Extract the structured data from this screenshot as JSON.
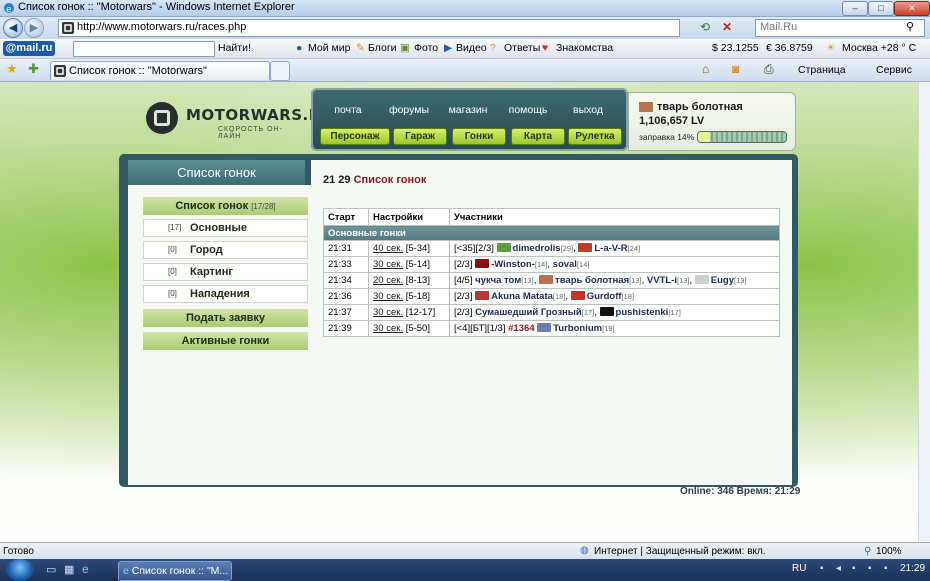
{
  "window": {
    "title": "Список гонок :: \"Motorwars\" - Windows Internet Explorer"
  },
  "address_bar": {
    "url": "http://www.motorwars.ru/races.php",
    "search_placeholder": "Mail.Ru"
  },
  "mail_toolbar": {
    "logo": "@mail.ru",
    "find_label": "Найти!",
    "items": [
      "Мой мир",
      "Блоги",
      "Фото",
      "Видео",
      "Ответы",
      "Знакомства"
    ],
    "usd": "$ 23.1255",
    "eur": "€ 36.8759",
    "weather": "Москва +28 ° C"
  },
  "tab": {
    "title": "Список гонок :: \"Motorwars\""
  },
  "ie_commands": {
    "page": "Страница",
    "tools": "Сервис"
  },
  "site": {
    "logo_name": "MOTORWARS.RU",
    "logo_sub": "СКОРОСТЬ ОН-ЛАЙН",
    "nav_top": [
      "почта",
      "форумы",
      "магазин",
      "помощь",
      "выход"
    ],
    "nav_bottom": [
      "Персонаж",
      "Гараж",
      "Гонки",
      "Карта",
      "Рулетка"
    ],
    "user": {
      "name": "тварь болотная",
      "money": "1,106,657 LV",
      "fuel_label": "заправка 14%",
      "fuel_percent": 14
    },
    "panel_title": "Список гонок",
    "menu": {
      "header": "Список гонок",
      "header_count": "[17/28]",
      "items": [
        {
          "count": "[17]",
          "label": "Основные"
        },
        {
          "count": "[0]",
          "label": "Город"
        },
        {
          "count": "[0]",
          "label": "Картинг"
        },
        {
          "count": "[0]",
          "label": "Нападения"
        }
      ],
      "submit": "Подать заявку",
      "active": "Активные гонки"
    },
    "heading_time": "21 29",
    "heading_title": "Список гонок",
    "table": {
      "headers": [
        "Старт",
        "Настройки",
        "Участники"
      ],
      "group": "Основные гонки",
      "rows": [
        {
          "start": "21:31",
          "time": "40 сек.",
          "range": "[5-34]",
          "prefix": "[<35][2/3]",
          "participants": [
            {
              "name": "dimedrolis",
              "level": "[29]",
              "color": "#5aa03a"
            },
            {
              "name": "L-a-V-R",
              "level": "[24]",
              "color": "#c0392b"
            }
          ]
        },
        {
          "start": "21:33",
          "time": "30 сек.",
          "range": "[5-14]",
          "prefix": "[2/3]",
          "participants": [
            {
              "name": "-Winston-",
              "level": "[14]",
              "color": "#8b1111"
            },
            {
              "name": "soval",
              "level": "[14]",
              "color": ""
            }
          ]
        },
        {
          "start": "21:34",
          "time": "20 сек.",
          "range": "[8-13]",
          "prefix": "[4/5]",
          "participants": [
            {
              "name": "чукча том",
              "level": "[13]",
              "color": ""
            },
            {
              "name": "тварь болотная",
              "level": "[13]",
              "color": "#b7744a"
            },
            {
              "name": "VVTL-i",
              "level": "[13]",
              "color": ""
            },
            {
              "name": "Eugy",
              "level": "[13]",
              "color": "#cfcfcf"
            }
          ]
        },
        {
          "start": "21:36",
          "time": "30 сек.",
          "range": "[5-18]",
          "prefix": "[2/3]",
          "participants": [
            {
              "name": "Akuna Matata",
              "level": "[18]",
              "color": "#b33a3a"
            },
            {
              "name": "Gurdoff",
              "level": "[18]",
              "color": "#d0302a"
            }
          ]
        },
        {
          "start": "21:37",
          "time": "30 сек.",
          "range": "[12-17]",
          "prefix": "[2/3]",
          "participants": [
            {
              "name": "Сумашедший Грозный",
              "level": "[17]",
              "color": ""
            },
            {
              "name": "pushistenki",
              "level": "[17]",
              "color": "#111111"
            }
          ]
        },
        {
          "start": "21:39",
          "time": "30 сек.",
          "range": "[5-50]",
          "prefix": "[<4][БТ][1/3]",
          "highlight": "#1364",
          "participants": [
            {
              "name": "Turbonium",
              "level": "[19]",
              "color": "#6b7fae"
            }
          ]
        }
      ]
    },
    "online": "Online: 346  Время: 21:29"
  },
  "statusbar": {
    "left": "Готово",
    "zone": "Интернет | Защищенный режим: вкл.",
    "zoom": "100%"
  },
  "taskbar": {
    "item": "Список гонок :: \"M...",
    "lang": "RU",
    "clock": "21:29"
  }
}
